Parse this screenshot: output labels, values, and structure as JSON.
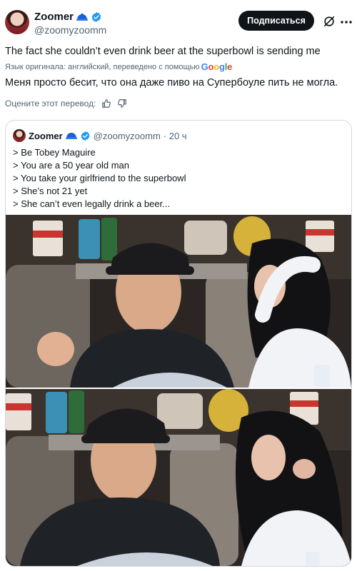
{
  "author": {
    "display_name": "Zoomer",
    "handle": "@zoomyzoomm",
    "avatar": "profile-photo",
    "badges": [
      "cap-icon",
      "verified-icon"
    ]
  },
  "header": {
    "follow_label": "Подписаться",
    "grok_icon": "grok-icon",
    "more_icon": "more-icon"
  },
  "tweet": {
    "text": "The fact she couldn’t even drink beer at the superbowl is sending me",
    "translation_note": "Язык оригинала: английский, переведено с помощью",
    "translation_provider": "Google",
    "translated_text": "Меня просто бесит, что она даже пиво на Супербоуле пить не могла.",
    "rate_prompt": "Оцените этот перевод:"
  },
  "quoted": {
    "display_name": "Zoomer",
    "handle": "@zoomyzoomm",
    "time": "· 20 ч",
    "lines": [
      "> Be Tobey Maguire",
      "> You are a 50 year old man",
      "> You take your girlfriend to the superbowl",
      "> She’s not 21 yet",
      "> She can’t even legally drink a beer..."
    ]
  },
  "colors": {
    "text": "#0f1419",
    "secondary": "#536471",
    "border": "#cfd9de",
    "verified": "#1d9bf0",
    "button": "#0f1419"
  }
}
